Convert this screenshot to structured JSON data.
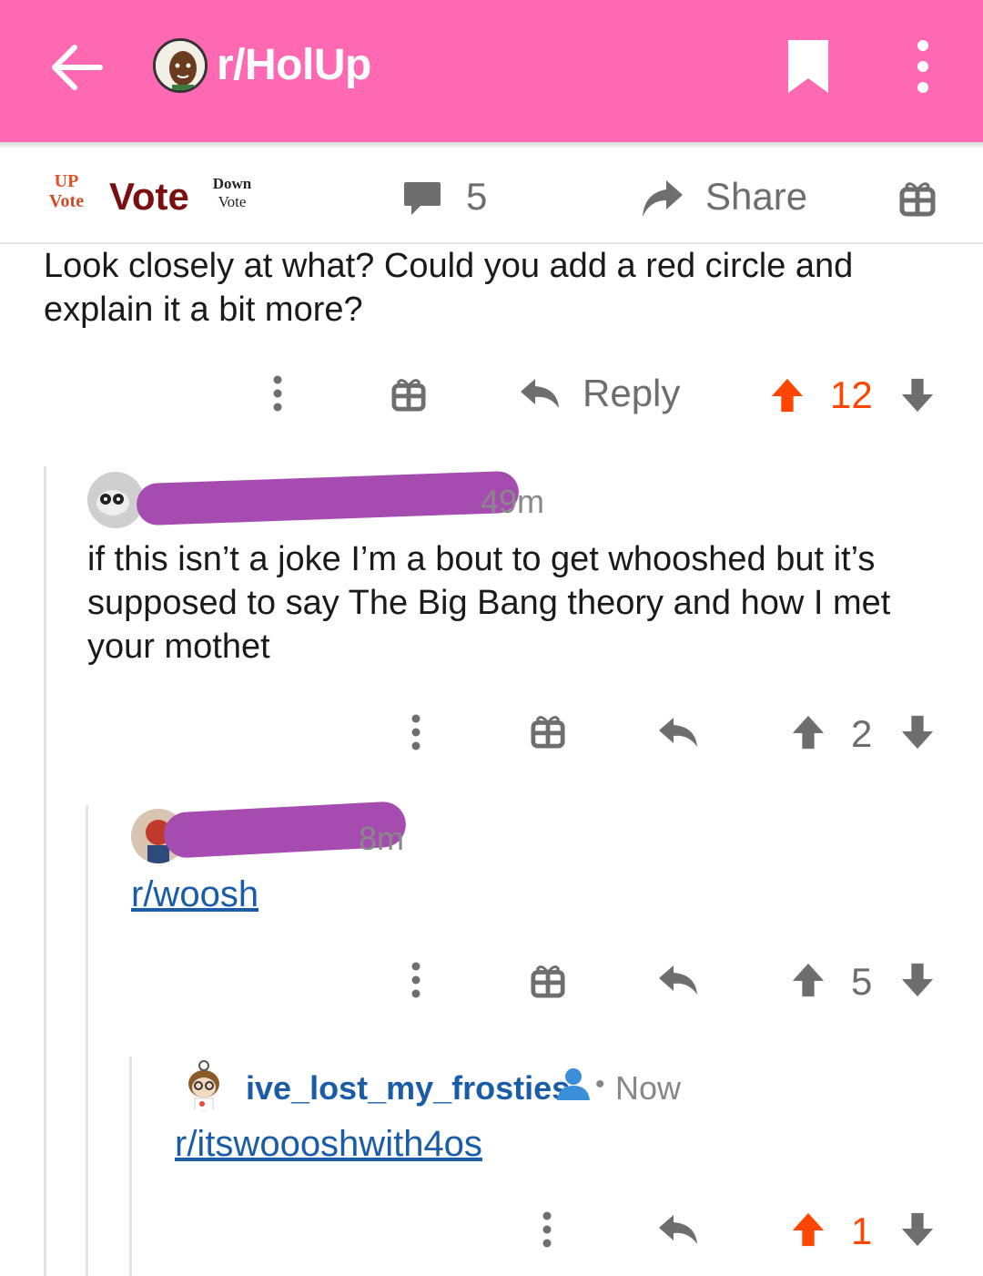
{
  "header": {
    "subreddit": "r/HolUp",
    "background_color": "#ff69b4"
  },
  "action_bar": {
    "up_vote_label_line1": "UP",
    "up_vote_label_line2": "Vote",
    "vote_label": "Vote",
    "down_vote_label_line1": "Down",
    "down_vote_label_line2": "Vote",
    "comment_count": "5",
    "share_label": "Share"
  },
  "comments": [
    {
      "text": "Look closely at what? Could you add a red circle and explain it a bit more?",
      "reply_label": "Reply",
      "score": "12",
      "upvoted": true
    },
    {
      "time": "49m",
      "text": "if this isn’t a joke I’m a bout to get whooshed but it’s supposed to say The Big Bang theory and how I met your mothet",
      "score": "2",
      "upvoted": false
    },
    {
      "time": "8m",
      "link": "r/woosh",
      "score": "5",
      "upvoted": false
    },
    {
      "username": "ive_lost_my_frosties",
      "time": "Now",
      "separator": "•",
      "link": "r/itswoooshwith4os",
      "score": "1",
      "upvoted": true
    }
  ],
  "colors": {
    "accent_orange": "#ff4500",
    "link_blue": "#1a5ca8",
    "icon_gray": "#6e6e6e",
    "redaction": "#a64cb0"
  }
}
